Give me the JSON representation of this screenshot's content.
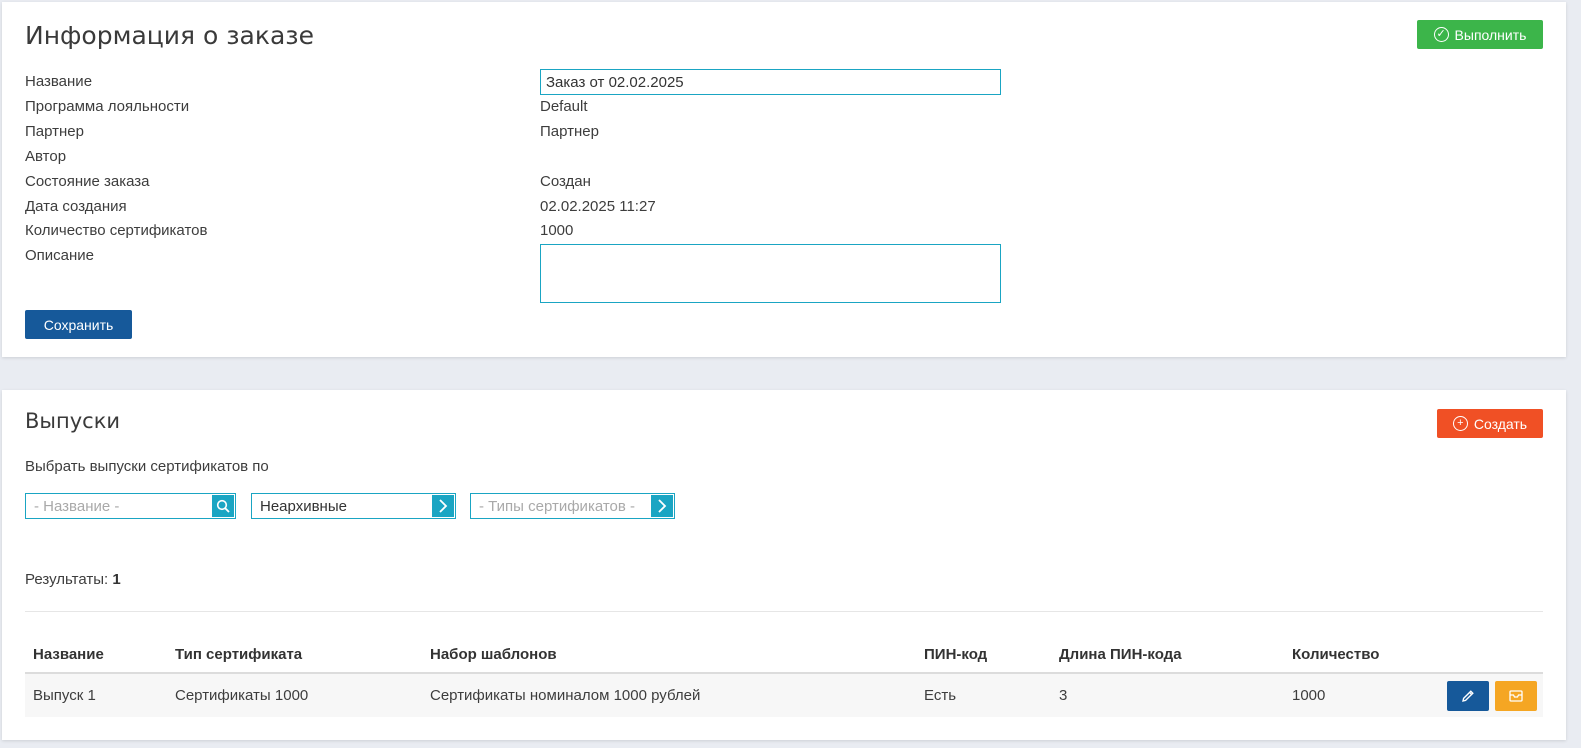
{
  "order": {
    "title": "Информация о заказе",
    "execute_button": "Выполнить",
    "fields": {
      "name_label": "Название",
      "name_value": "Заказ от 02.02.2025",
      "loyalty_label": "Программа лояльности",
      "loyalty_value": "Default",
      "partner_label": "Партнер",
      "partner_value": "Партнер",
      "author_label": "Автор",
      "author_value": "",
      "status_label": "Состояние заказа",
      "status_value": "Создан",
      "created_label": "Дата создания",
      "created_value": "02.02.2025 11:27",
      "count_label": "Количество сертификатов",
      "count_value": "1000",
      "description_label": "Описание",
      "description_value": ""
    },
    "save_button": "Сохранить"
  },
  "issues": {
    "title": "Выпуски",
    "create_button": "Создать",
    "filter_caption": "Выбрать выпуски сертификатов по",
    "filters": {
      "name_placeholder": "- Название -",
      "archive_value": "Неархивные",
      "types_placeholder": "- Типы сертификатов -"
    },
    "results_label": "Результаты:",
    "results_count": "1",
    "table": {
      "columns": [
        "Название",
        "Тип сертификата",
        "Набор шаблонов",
        "ПИН-код",
        "Длина ПИН-кода",
        "Количество"
      ],
      "rows": [
        [
          "Выпуск 1",
          "Сертификаты 1000",
          "Сертификаты номиналом 1000 рублей",
          "Есть",
          "3",
          "1000"
        ]
      ]
    }
  },
  "icons": {
    "execute": "check-circle-icon",
    "create": "plus-circle-icon",
    "search": "search-icon",
    "chevron": "chevron-right-icon",
    "edit": "pencil-icon",
    "archive": "archive-box-icon"
  },
  "colors": {
    "accent": "#1aa5c3",
    "primary": "#16599a",
    "success": "#3cb54a",
    "danger": "#f05025",
    "warning": "#f5a623"
  }
}
